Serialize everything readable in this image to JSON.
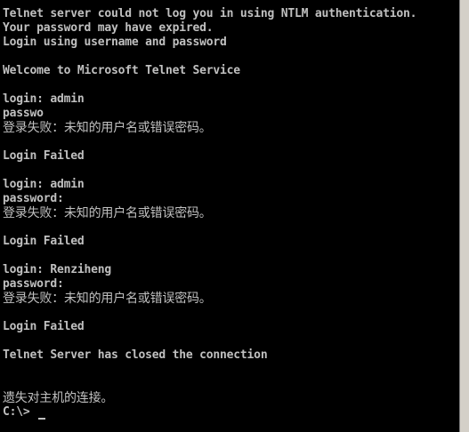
{
  "terminal": {
    "lines": [
      "Telnet server could not log you in using NTLM authentication.",
      "Your password may have expired.",
      "Login using username and password",
      "",
      "Welcome to Microsoft Telnet Service",
      "",
      "login: admin",
      "passwo",
      "登录失败：未知的用户名或错误密码。",
      "",
      "Login Failed",
      "",
      "login: admin",
      "password:",
      "登录失败：未知的用户名或错误密码。",
      "",
      "Login Failed",
      "",
      "login: Renziheng",
      "password:",
      "登录失败：未知的用户名或错误密码。",
      "",
      "Login Failed",
      "",
      "Telnet Server has closed the connection",
      "",
      "",
      "遗失对主机的连接。",
      "C:\\>"
    ]
  },
  "colors": {
    "background": "#000000",
    "text": "#c0c0c0"
  }
}
